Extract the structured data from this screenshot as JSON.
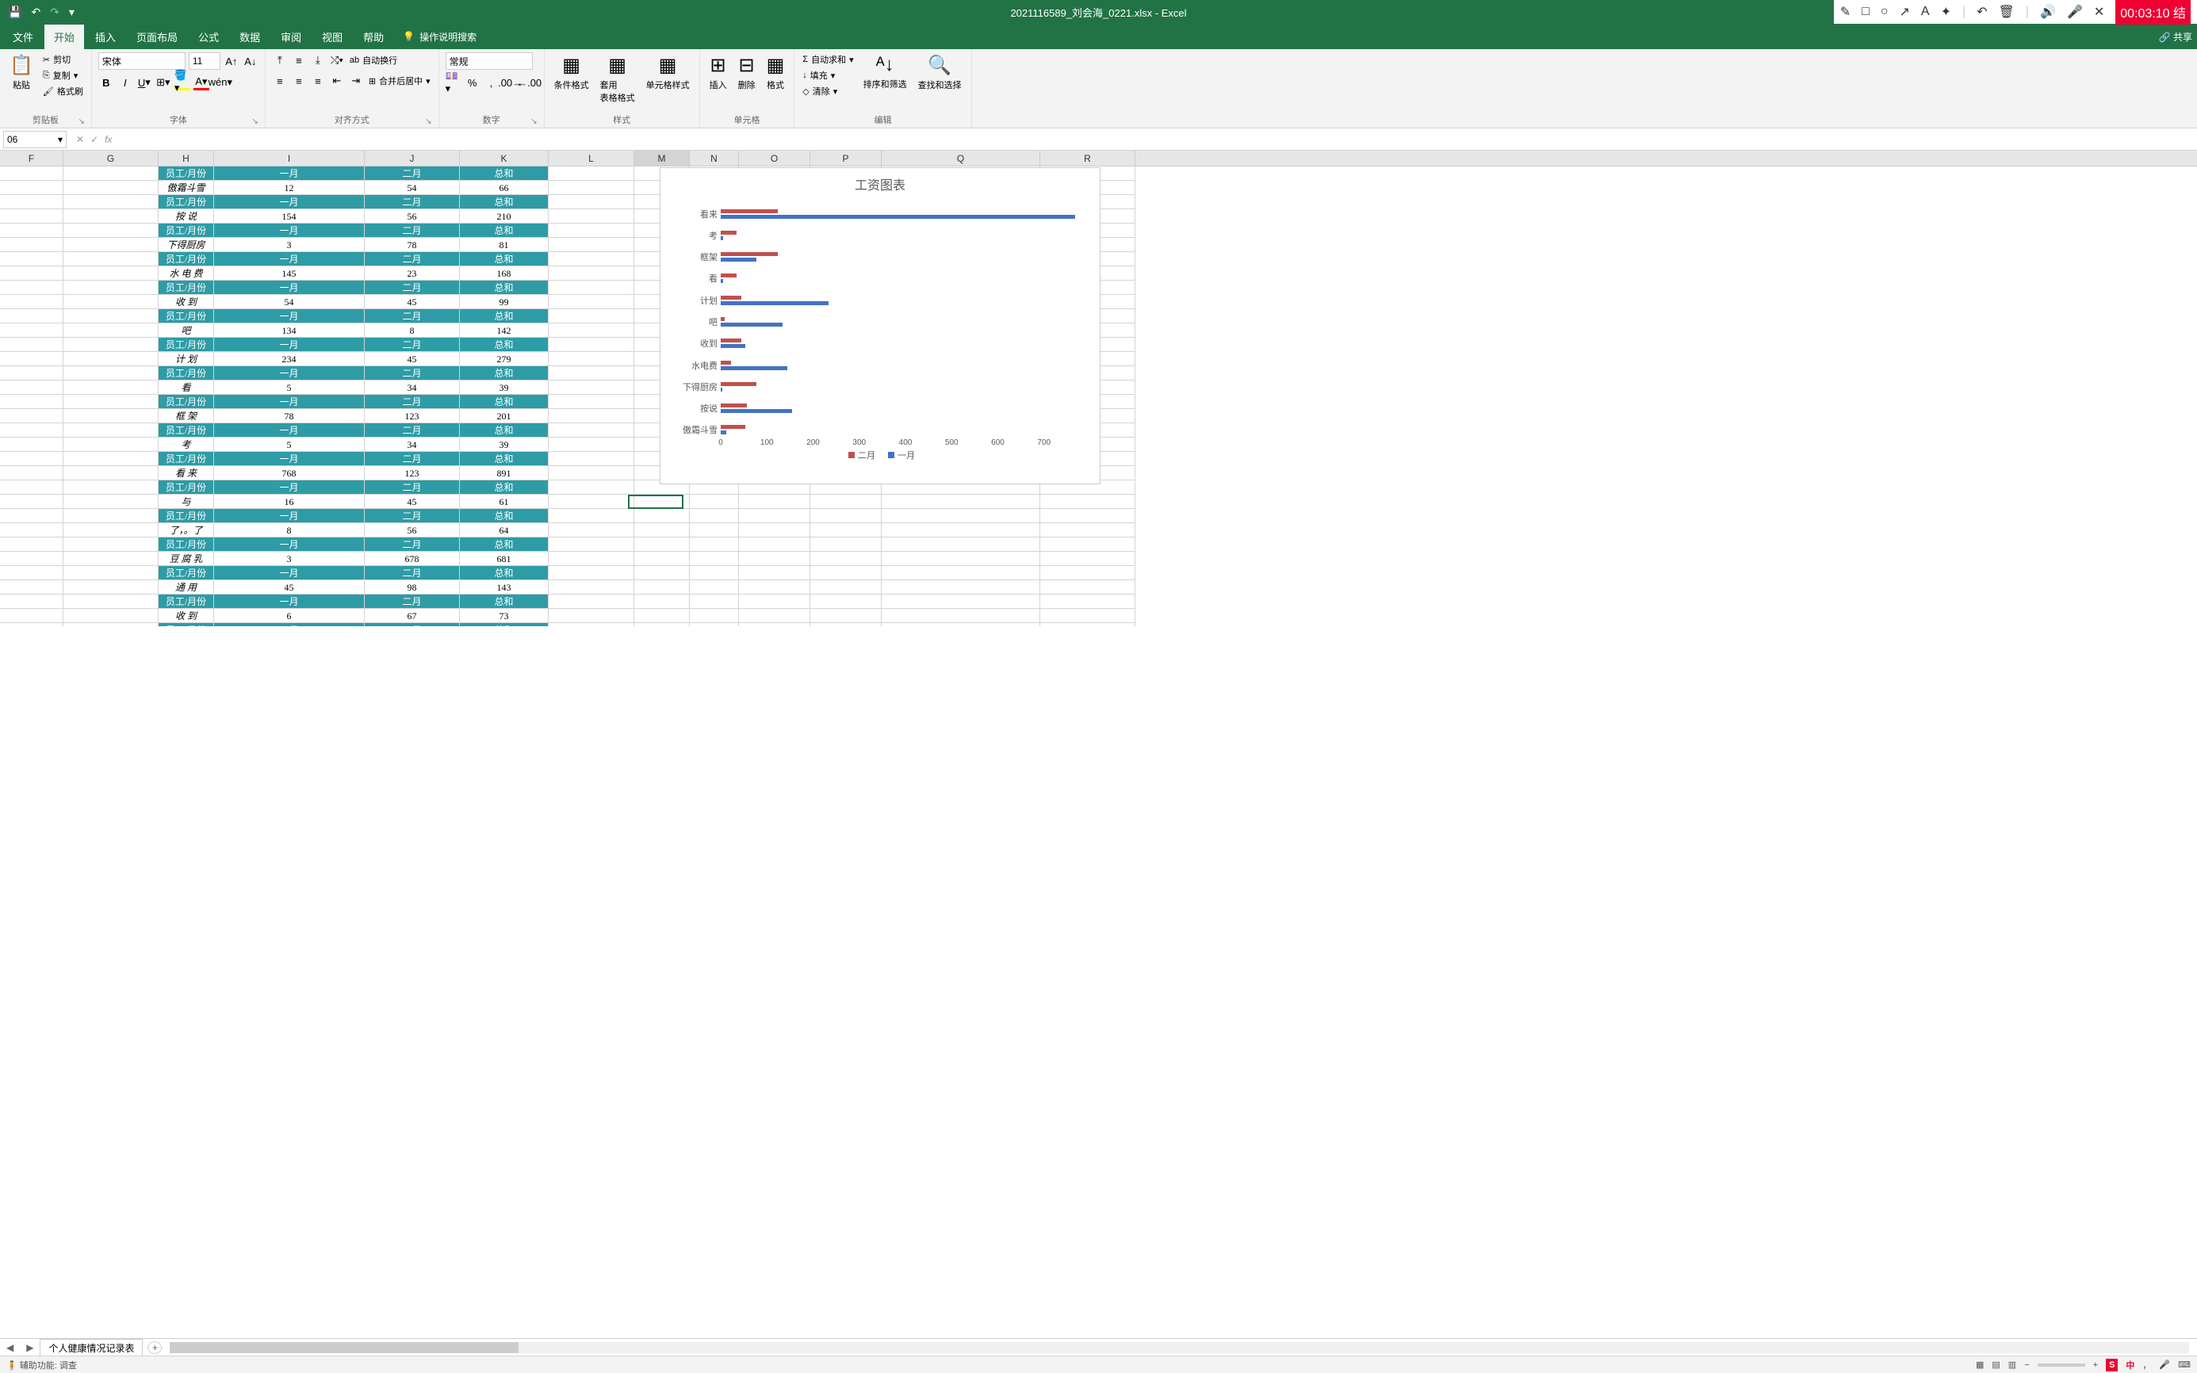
{
  "titlebar": {
    "doc_title": "2021116589_刘会海_0221.xlsx - Excel",
    "timer": "00:03:10 结"
  },
  "tabs": {
    "file": "文件",
    "home": "开始",
    "insert": "插入",
    "layout": "页面布局",
    "formulas": "公式",
    "data": "数据",
    "review": "审阅",
    "view": "视图",
    "help": "帮助",
    "tell_me": "操作说明搜索",
    "share": "共享"
  },
  "ribbon": {
    "clipboard": {
      "label": "剪贴板",
      "paste": "粘贴",
      "cut": "剪切",
      "copy": "复制",
      "format_painter": "格式刷"
    },
    "font": {
      "label": "字体",
      "name": "宋体",
      "size": "11"
    },
    "alignment": {
      "label": "对齐方式",
      "wrap": "自动换行",
      "merge": "合并后居中"
    },
    "number": {
      "label": "数字",
      "format": "常规"
    },
    "styles": {
      "label": "样式",
      "cond": "条件格式",
      "table": "套用\n表格格式",
      "cell": "单元格样式"
    },
    "cells": {
      "label": "单元格",
      "insert": "插入",
      "delete": "删除",
      "format": "格式"
    },
    "editing": {
      "label": "编辑",
      "sum": "自动求和",
      "fill": "填充",
      "clear": "清除",
      "sort": "排序和筛选",
      "find": "查找和选择"
    }
  },
  "formula_bar": {
    "name_box": "06"
  },
  "columns": [
    "F",
    "G",
    "H",
    "I",
    "J",
    "K",
    "L",
    "M",
    "N",
    "O",
    "P",
    "Q",
    "R"
  ],
  "header_row_labels": {
    "employee": "员工/月份",
    "month1": "一月",
    "month2": "二月",
    "sum": "总和"
  },
  "table_rows": [
    {
      "name": "傲霜斗雪",
      "m1": "12",
      "m2": "54",
      "sum": "66"
    },
    {
      "name": "按    说",
      "m1": "154",
      "m2": "56",
      "sum": "210"
    },
    {
      "name": "下得厨房",
      "m1": "3",
      "m2": "78",
      "sum": "81"
    },
    {
      "name": "水 电 费",
      "m1": "145",
      "m2": "23",
      "sum": "168"
    },
    {
      "name": "收    到",
      "m1": "54",
      "m2": "45",
      "sum": "99"
    },
    {
      "name": "吧",
      "m1": "134",
      "m2": "8",
      "sum": "142"
    },
    {
      "name": "计    划",
      "m1": "234",
      "m2": "45",
      "sum": "279"
    },
    {
      "name": "看",
      "m1": "5",
      "m2": "34",
      "sum": "39"
    },
    {
      "name": "框    架",
      "m1": "78",
      "m2": "123",
      "sum": "201"
    },
    {
      "name": "考",
      "m1": "5",
      "m2": "34",
      "sum": "39"
    },
    {
      "name": "看    来",
      "m1": "768",
      "m2": "123",
      "sum": "891"
    },
    {
      "name": "与",
      "m1": "16",
      "m2": "45",
      "sum": "61"
    },
    {
      "name": "了，。了",
      "m1": "8",
      "m2": "56",
      "sum": "64"
    },
    {
      "name": "豆 腐 乳",
      "m1": "3",
      "m2": "678",
      "sum": "681"
    },
    {
      "name": "通    用",
      "m1": "45",
      "m2": "98",
      "sum": "143"
    },
    {
      "name": "收    到",
      "m1": "6",
      "m2": "67",
      "sum": "73"
    }
  ],
  "chart_data": {
    "type": "bar",
    "title": "工资图表",
    "categories": [
      "看来",
      "考",
      "框架",
      "看",
      "计划",
      "吧",
      "收到",
      "水电费",
      "下得厨房",
      "按说",
      "傲霜斗雪"
    ],
    "series": [
      {
        "name": "二月",
        "color": "#c0504d",
        "values": [
          123,
          34,
          123,
          34,
          45,
          8,
          45,
          23,
          78,
          56,
          54
        ]
      },
      {
        "name": "一月",
        "color": "#4472c4",
        "values": [
          768,
          5,
          78,
          5,
          234,
          134,
          54,
          145,
          3,
          154,
          12
        ]
      }
    ],
    "xlim": [
      0,
      800
    ],
    "xticks": [
      0,
      100,
      200,
      300,
      400,
      500,
      600,
      700
    ],
    "legend": [
      "二月",
      "一月"
    ]
  },
  "sheet": {
    "tab1": "个人健康情况记录表"
  },
  "status": {
    "acc": "辅助功能: 调查",
    "ime_lang": "中",
    "punct": "，"
  }
}
